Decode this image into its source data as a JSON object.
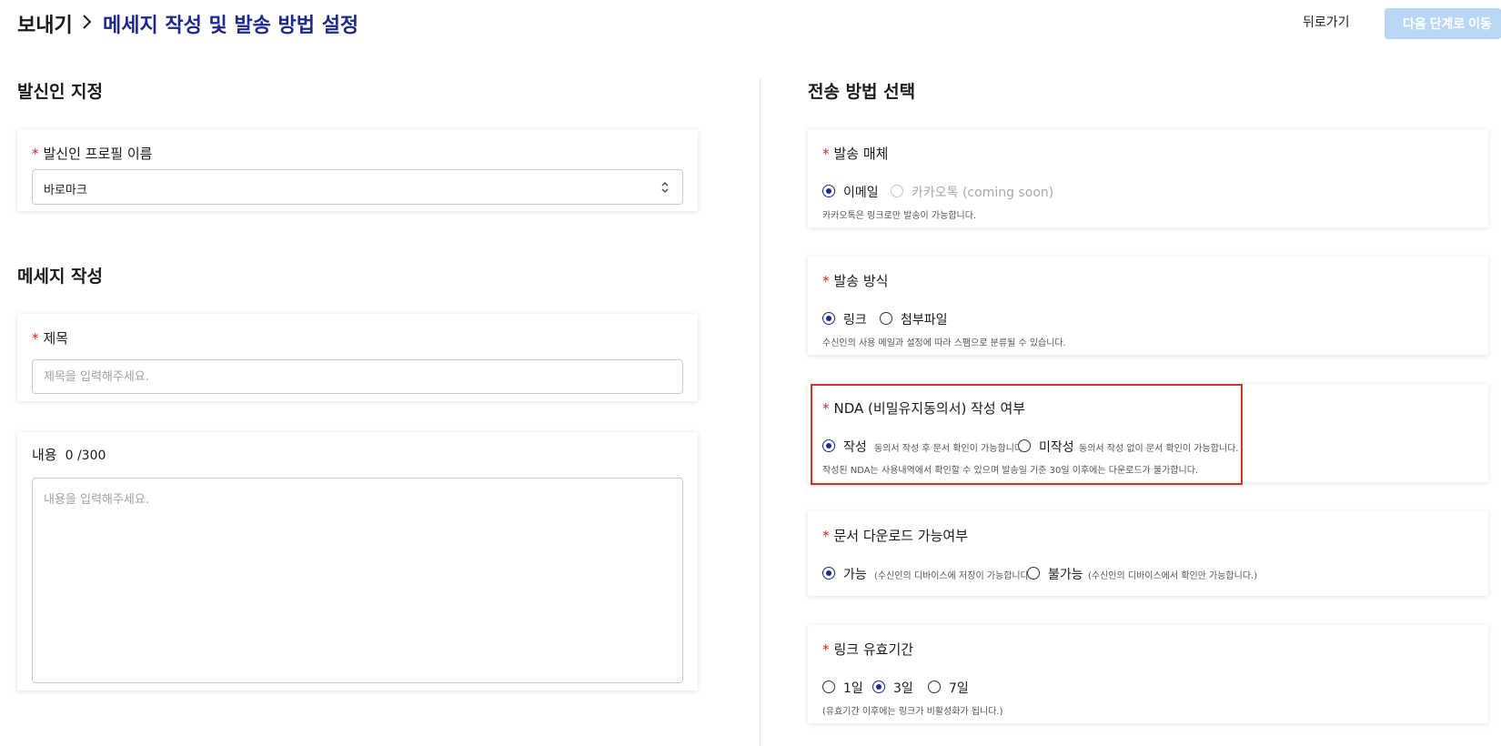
{
  "header": {
    "breadcrumb_root": "보내기",
    "breadcrumb_current": "메세지 작성 및 발송 방법 설정",
    "back_label": "뒤로가기",
    "next_label": "다음 단계로 이동"
  },
  "left": {
    "sender_section_title": "발신인 지정",
    "sender_profile": {
      "label": "발신인 프로필 이름",
      "value": "바로마크"
    },
    "message_section_title": "메세지 작성",
    "subject": {
      "label": "제목",
      "placeholder": "제목을 입력해주세요."
    },
    "content": {
      "label": "내용",
      "counter": "0 /300",
      "placeholder": "내용을 입력해주세요."
    }
  },
  "right": {
    "section_title": "전송 방법 선택",
    "medium": {
      "label": "발송 매체",
      "options": [
        "이메일",
        "카카오톡 (coming soon)"
      ],
      "selected": "이메일",
      "hint": "카카오톡은 링크로만 발송이 가능합니다."
    },
    "method": {
      "label": "발송 방식",
      "options": [
        "링크",
        "첨부파일"
      ],
      "selected": "링크",
      "hint": "수신인의 사용 메일과 설정에 따라 스팸으로 분류될 수 있습니다."
    },
    "nda": {
      "label": "NDA (비밀유지동의서) 작성 여부",
      "options": [
        "작성",
        "미작성"
      ],
      "option_hints": [
        "동의서 작성 후 문서 확인이 가능합니다.",
        "동의서 작성 없이 문서 확인이 가능합니다."
      ],
      "selected": "작성",
      "hint": "작성된 NDA는 사용내역에서 확인할 수 있으며 발송일 기준 30일 이후에는 다운로드가 불가합니다."
    },
    "download": {
      "label": "문서 다운로드 가능여부",
      "options": [
        "가능",
        "불가능"
      ],
      "option_hints": [
        "(수신인의 디바이스에 저장이 가능합니다.)",
        "(수신인의 디바이스에서 확인만 가능합니다.)"
      ],
      "selected": "가능"
    },
    "validity": {
      "label": "링크 유효기간",
      "options": [
        "1일",
        "3일",
        "7일"
      ],
      "selected": "3일",
      "hint": "(유효기간 이후에는 링크가 비활성화가 됩니다.)"
    }
  },
  "colors": {
    "accent": "#1d2a8c",
    "required": "#e02020",
    "next_button_disabled": "#b8d7f5",
    "highlight_border": "#d63322"
  }
}
